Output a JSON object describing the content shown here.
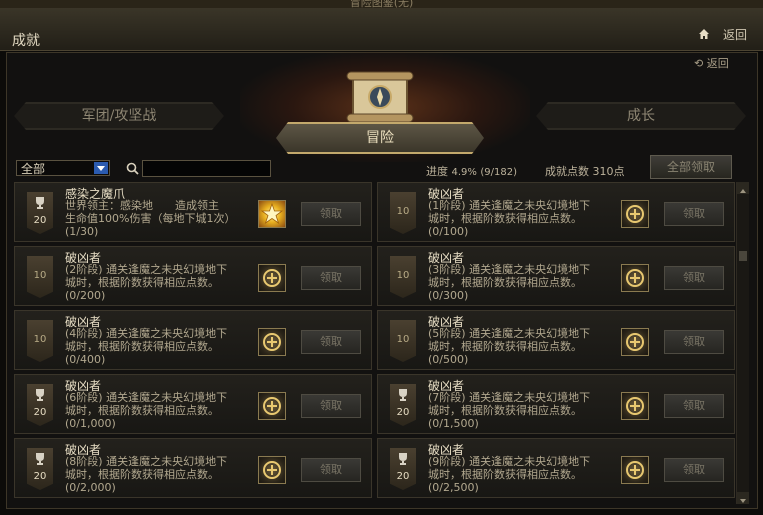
{
  "window": {
    "title": "冒险图鉴(无)"
  },
  "header": {
    "title": "成就",
    "back_label": "返回"
  },
  "panel": {
    "back_label": "返回"
  },
  "tabs": [
    {
      "label": "军团/攻坚战",
      "active": false
    },
    {
      "label": "冒险",
      "active": true
    },
    {
      "label": "成长",
      "active": false
    }
  ],
  "filter": {
    "selected": "全部"
  },
  "search": {
    "value": "",
    "placeholder": ""
  },
  "progress": {
    "label": "进度",
    "percent_text": "4.9%",
    "count_text": "(9/182)"
  },
  "points": {
    "text": "成就点数 310点"
  },
  "claim_all_label": "全部领取",
  "claim_label": "领取",
  "colors": {
    "accent_gold": "#c3a96c",
    "filter_arrow": "#2b5bb0"
  },
  "cards": [
    {
      "title": "感染之魔爪",
      "desc_lines": [
        "世界领主：感染地　　造成领主",
        "生命值100%伤害（每地下城1次）"
      ],
      "progress": "(1/30)",
      "points": "20",
      "badge_icon": "trophy-icon",
      "reward_icon": "star-reward-icon"
    },
    {
      "title": "破凶者",
      "desc_lines": [
        "(1阶段) 通关逢魔之未央幻境地下",
        "城时，根据阶数获得相应点数。"
      ],
      "progress": "(0/100)",
      "points": "10",
      "badge_icon": "",
      "reward_icon": "sigil-reward-icon"
    },
    {
      "title": "破凶者",
      "desc_lines": [
        "(2阶段) 通关逢魔之未央幻境地下",
        "城时，根据阶数获得相应点数。"
      ],
      "progress": "(0/200)",
      "points": "10",
      "badge_icon": "",
      "reward_icon": "sigil-reward-icon"
    },
    {
      "title": "破凶者",
      "desc_lines": [
        "(3阶段) 通关逢魔之未央幻境地下",
        "城时，根据阶数获得相应点数。"
      ],
      "progress": "(0/300)",
      "points": "10",
      "badge_icon": "",
      "reward_icon": "sigil-reward-icon"
    },
    {
      "title": "破凶者",
      "desc_lines": [
        "(4阶段) 通关逢魔之未央幻境地下",
        "城时，根据阶数获得相应点数。"
      ],
      "progress": "(0/400)",
      "points": "10",
      "badge_icon": "",
      "reward_icon": "sigil-reward-icon"
    },
    {
      "title": "破凶者",
      "desc_lines": [
        "(5阶段) 通关逢魔之未央幻境地下",
        "城时，根据阶数获得相应点数。"
      ],
      "progress": "(0/500)",
      "points": "10",
      "badge_icon": "",
      "reward_icon": "sigil-reward-icon"
    },
    {
      "title": "破凶者",
      "desc_lines": [
        "(6阶段) 通关逢魔之未央幻境地下",
        "城时，根据阶数获得相应点数。"
      ],
      "progress": "(0/1,000)",
      "points": "20",
      "badge_icon": "trophy-icon",
      "reward_icon": "sigil-reward-icon"
    },
    {
      "title": "破凶者",
      "desc_lines": [
        "(7阶段) 通关逢魔之未央幻境地下",
        "城时，根据阶数获得相应点数。"
      ],
      "progress": "(0/1,500)",
      "points": "20",
      "badge_icon": "trophy-icon",
      "reward_icon": "sigil-reward-icon"
    },
    {
      "title": "破凶者",
      "desc_lines": [
        "(8阶段) 通关逢魔之未央幻境地下",
        "城时，根据阶数获得相应点数。"
      ],
      "progress": "(0/2,000)",
      "points": "20",
      "badge_icon": "trophy-icon",
      "reward_icon": "sigil-reward-icon"
    },
    {
      "title": "破凶者",
      "desc_lines": [
        "(9阶段) 通关逢魔之未央幻境地下",
        "城时，根据阶数获得相应点数。"
      ],
      "progress": "(0/2,500)",
      "points": "20",
      "badge_icon": "trophy-icon",
      "reward_icon": "sigil-reward-icon"
    }
  ]
}
